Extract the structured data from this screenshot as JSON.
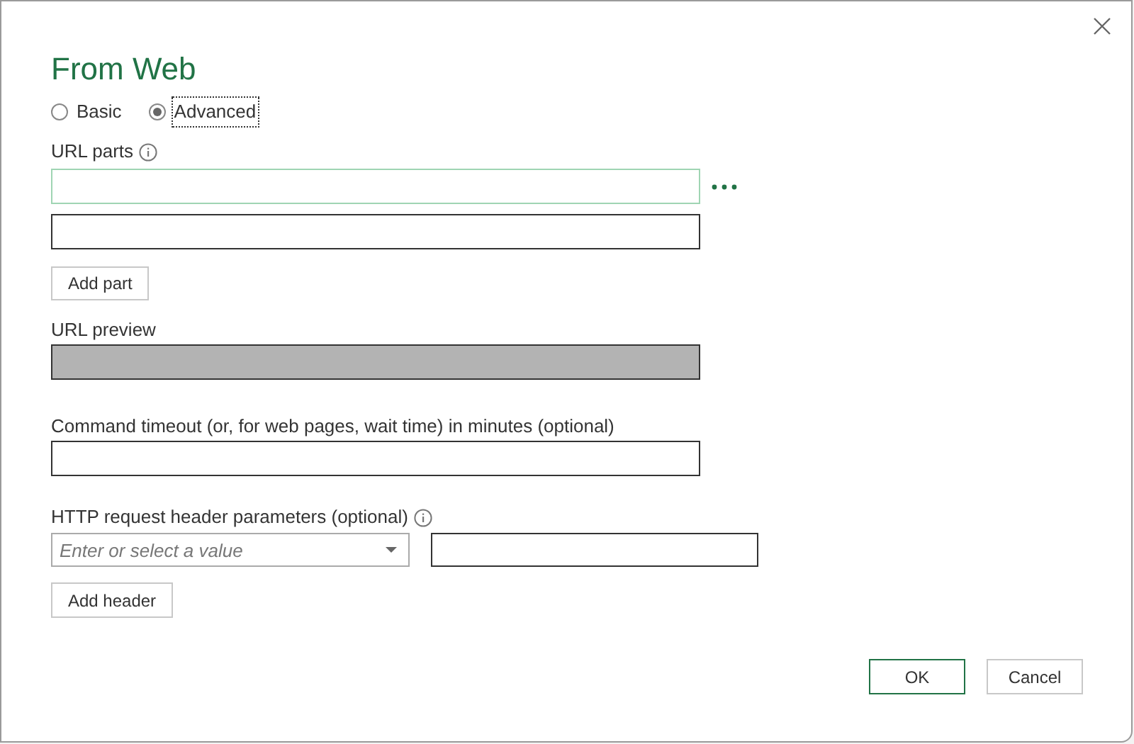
{
  "dialog": {
    "title": "From Web"
  },
  "modes": [
    {
      "label": "Basic",
      "selected": false,
      "focused": false
    },
    {
      "label": "Advanced",
      "selected": true,
      "focused": true
    }
  ],
  "url_parts": {
    "label": "URL parts",
    "fields": [
      {
        "focused": true
      },
      {
        "focused": false
      }
    ],
    "add_button": "Add part"
  },
  "url_preview": {
    "label": "URL preview"
  },
  "timeout": {
    "label": "Command timeout (or, for web pages, wait time) in minutes (optional)"
  },
  "headers": {
    "label": "HTTP request header parameters (optional)",
    "name_placeholder": "Enter or select a value",
    "add_button": "Add header"
  },
  "buttons": [
    {
      "label": "OK",
      "kind": "primary"
    },
    {
      "label": "Cancel",
      "kind": "secondary"
    }
  ]
}
